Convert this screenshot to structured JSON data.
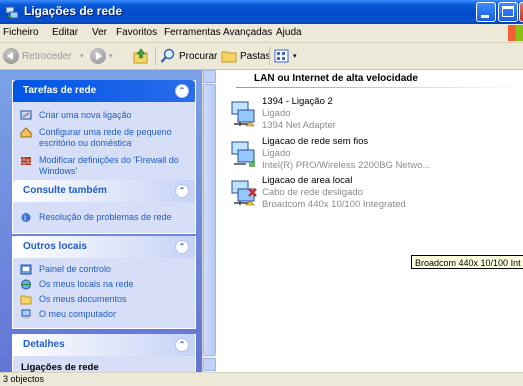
{
  "window": {
    "title": "Ligações de rede"
  },
  "menu": [
    "Ficheiro",
    "Editar",
    "Ver",
    "Favoritos",
    "Ferramentas",
    "Avançadas",
    "Ajuda"
  ],
  "toolbar": {
    "back": "Retroceder",
    "search": "Procurar",
    "folders": "Pastas"
  },
  "sidebar": {
    "tasks": {
      "title": "Tarefas de rede",
      "items": [
        {
          "label": "Criar uma nova ligação",
          "icon": "new-connection-icon"
        },
        {
          "label": "Configurar uma rede de pequeno escritório ou doméstica",
          "icon": "home-network-icon"
        },
        {
          "label": "Modificar definições do 'Firewall do Windows'",
          "icon": "firewall-icon"
        }
      ]
    },
    "see_also": {
      "title": "Consulte também",
      "items": [
        {
          "label": "Resolução de problemas de rede",
          "icon": "help-icon"
        }
      ]
    },
    "other_places": {
      "title": "Outros locais",
      "items": [
        {
          "label": "Painel de controlo",
          "icon": "control-panel-icon"
        },
        {
          "label": "Os meus locais na rede",
          "icon": "network-places-icon"
        },
        {
          "label": "Os meus documentos",
          "icon": "documents-icon"
        },
        {
          "label": "O meu computador",
          "icon": "computer-icon"
        }
      ]
    },
    "details": {
      "title": "Detalhes",
      "subtitle": "Ligações de rede"
    }
  },
  "content": {
    "group_title": "LAN ou Internet de alta velocidade",
    "connections": [
      {
        "name": "1394 - Ligação 2",
        "status": "Ligado",
        "adapter": "1394 Net Adapter",
        "state": "connected"
      },
      {
        "name": "Ligacao de rede sem fios",
        "status": "Ligado",
        "adapter": "Intel(R) PRO/Wireless 2200BG Netwo...",
        "state": "connected"
      },
      {
        "name": "Ligacao de area local",
        "status": "Cabo de rede desligado",
        "adapter": "Broadcom 440x 10/100 Integrated",
        "state": "disconnected"
      }
    ]
  },
  "tooltip": "Broadcom 440x 10/100 Int",
  "statusbar": "3 objectos",
  "colors": {
    "titlebar": "#0a5bd8",
    "task_link": "#215dc6",
    "pane_bg": "#7ba2e7"
  }
}
